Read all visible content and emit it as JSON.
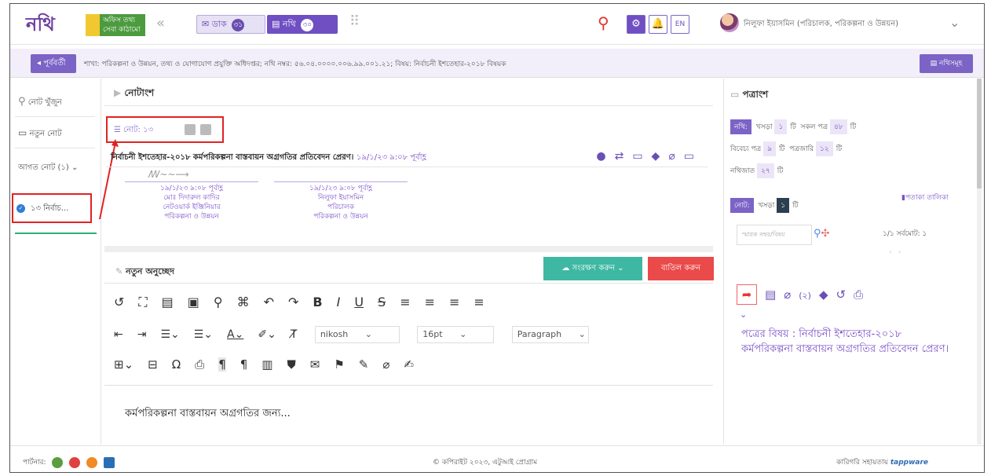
{
  "header": {
    "logo": "নথি",
    "badge": "অফিস তথ্য সেবা কাঠামো",
    "dak_label": "ডাক",
    "dak_count": "৩১",
    "nothi_label": "নথি",
    "nothi_count": "৩০",
    "lang": "EN",
    "user": "নিলুফা ইয়াসমিন (পরিচালক, পরিকল্পনা ও উন্নয়ন)"
  },
  "infobar": {
    "back": "পূর্ববর্তী",
    "path": "শাখা: পরিকল্পনা ও উন্নয়ন, তথ্য ও যোগাযোগ প্রযুক্তি অধিদপ্তর; নথি নম্বর: ৫৬.০৪.০০০০.০০৬.৯৯.০০১.২১; বিষয়: নির্বাচনী ইশতেহার-২০১৮ বিষয়ক",
    "nothi_list": "নথিসমূহ"
  },
  "sidebar": {
    "search": "নোট খুঁজুন",
    "new_note": "নতুন নোট",
    "incoming": "আগত নোট (১)",
    "selected_note": "১৩ নির্বাচ..."
  },
  "notes": {
    "title": "নোটাংশ",
    "tag": "নোট: ১৩",
    "heading": "নির্বাচনী ইশতেহার-২০১৮ কর্মপরিকল্পনা বাস্তবায়ন অগ্রগতির প্রতিবেদন প্রেরণ।",
    "heading_time": "১৯/১/২৩ ৯:০৮ পূর্বাহ্ণ",
    "sig1": {
      "time": "১৯/১/২৩ ৯:০৮ পূর্বাহ্ণ",
      "name": "মোঃ দিদারুল কাদির",
      "role": "নেটওয়ার্ক ইঞ্জিনিয়ার",
      "dept": "পরিকল্পনা ও উন্নয়ন"
    },
    "sig2": {
      "time": "১৯/১/২৩ ৯:০৮ পূর্বাহ্ণ",
      "name": "নিলুফা ইয়াসমিন",
      "role": "পরিচালক",
      "dept": "পরিকল্পনা ও উন্নয়ন"
    }
  },
  "editor": {
    "title": "নতুন অনুচ্ছেদ",
    "save": "সংরক্ষণ করুন",
    "cancel": "বাতিল করুন",
    "font": "nikosh",
    "size": "16pt",
    "block": "Paragraph",
    "content": "কর্মপরিকল্পনা বাস্তবায়ন অগ্রগতির জন্য..."
  },
  "patrangsho": {
    "title": "পত্রাংশ",
    "nothi": "নথি:",
    "draft": "খসড়া",
    "draft_count": "১",
    "unit": "টি",
    "all_letters": "সকল পত্র",
    "all_count": "৪৮",
    "attached": "বিবেচ্য পত্র",
    "attached_count": "৯",
    "patrajari": "পত্রজারি",
    "patrajari_count": "১২",
    "nothijat": "নথিজাত",
    "nothijat_count": "২৭",
    "note_tag": "নোট:",
    "note_draft": "খসড়া",
    "note_draft_count": "১",
    "flag_list": "পতাকা তালিকা",
    "search_placeholder": "স্মারক নম্বর/বিষয়",
    "page_info": "১/১ সর্বমোট: ১",
    "attach_count": "(২)",
    "subject": "পত্রের বিষয় : নির্বাচনী ইশতেহার-২০১৮ কর্মপরিকল্পনা বাস্তবায়ন অগ্রগতির প্রতিবেদন প্রেরণ।"
  },
  "footer": {
    "partners": "পার্টনার:",
    "copyright": "© কপিরাইট ২০২৩, এটুআই প্রোগ্রাম",
    "tech_label": "কারিগরি সহায়তায়",
    "tech_brand": "tappware"
  }
}
